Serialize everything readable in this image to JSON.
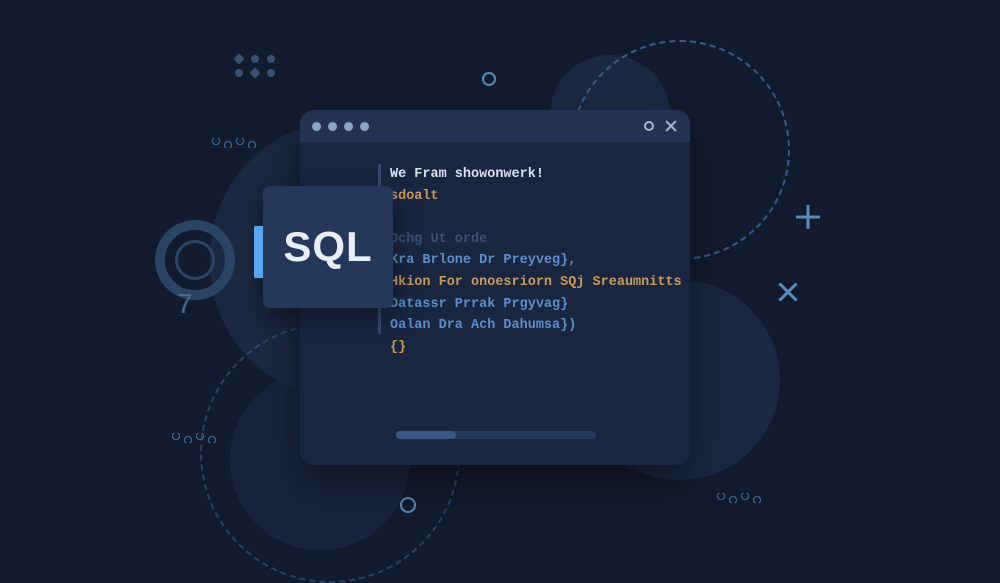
{
  "badge": {
    "label": "SQL"
  },
  "decor": {
    "seven": "7"
  },
  "editor": {
    "lines": [
      {
        "text": "We Fram showonwerk!",
        "cls": "c-white"
      },
      {
        "text": "sdoalt",
        "cls": "c-orange"
      },
      {
        "text": "",
        "cls": ""
      },
      {
        "text": "Dchg Ut orde",
        "cls": "c-dim"
      },
      {
        "text": "Kra Brlone Dr Preyveg},",
        "cls": "c-blue"
      },
      {
        "text": "Hkion For onoesriorn SQj Sreaumnitts",
        "cls": "c-orange"
      },
      {
        "text": "Datassr Prrak Prgyvag}",
        "cls": "c-blue"
      },
      {
        "text": "Oalan Dra Ach Dahumsa})",
        "cls": "c-blue"
      },
      {
        "text": "{}",
        "cls": "c-orange"
      }
    ]
  }
}
